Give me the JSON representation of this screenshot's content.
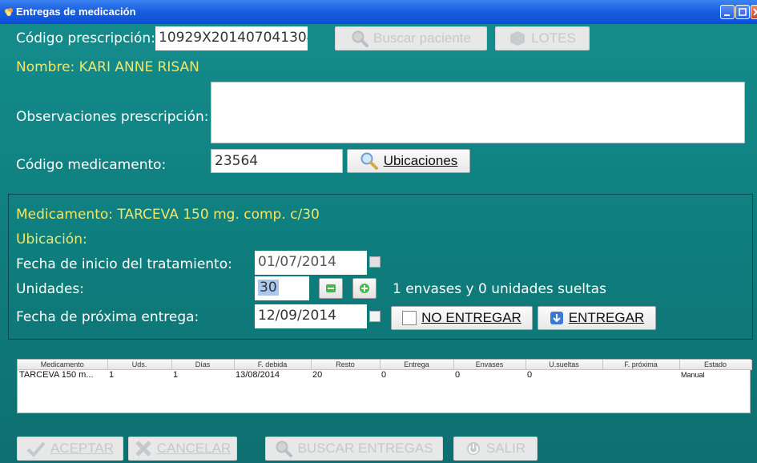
{
  "window": {
    "title": "Entregas de medicación"
  },
  "prescription": {
    "code_label": "Código prescripción:",
    "code_value": "10929X201407041304",
    "search_patient_label": "Buscar paciente",
    "lotes_label": "LOTES",
    "name_line": "Nombre: KARI ANNE RISAN",
    "observations_label": "Observaciones prescripción:",
    "observations_value": ""
  },
  "medication_code": {
    "label": "Código medicamento:",
    "value": "23564",
    "locations_button": "Ubicaciones"
  },
  "details": {
    "medication_line": "Medicamento: TARCEVA 150 mg. comp. c/30",
    "location_line": "Ubicación:",
    "start_date_label": "Fecha de inicio del tratamiento:",
    "start_date_value": "01/07/2014",
    "units_label": "Unidades:",
    "units_value": "30",
    "units_summary": "1 envases y 0 unidades sueltas",
    "next_date_label": "Fecha de próxima entrega:",
    "next_date_value": "12/09/2014",
    "no_deliver_button": "NO ENTREGAR",
    "deliver_button": "ENTREGAR"
  },
  "grid": {
    "columns": [
      "Medicamento",
      "Uds.",
      "Días",
      "F. debida",
      "Resto",
      "Entrega",
      "Envases",
      "U.sueltas",
      "F. próxima",
      "Estado"
    ],
    "rows": [
      [
        "TARCEVA 150 m...",
        "1",
        "1",
        "13/08/2014",
        "20",
        "0",
        "0",
        "0",
        "",
        "Manual"
      ]
    ]
  },
  "footer": {
    "accept": "ACEPTAR",
    "cancel": "CANCELAR",
    "search_deliveries": "BUSCAR ENTREGAS",
    "exit": "SALIR"
  },
  "icons": {
    "app": "app-icon",
    "search": "magnifier-icon",
    "minus": "minus-icon",
    "plus": "plus-icon",
    "calendar": "calendar-icon",
    "deliver": "deliver-icon",
    "check": "check-icon",
    "cross": "cross-icon",
    "power": "power-icon"
  }
}
